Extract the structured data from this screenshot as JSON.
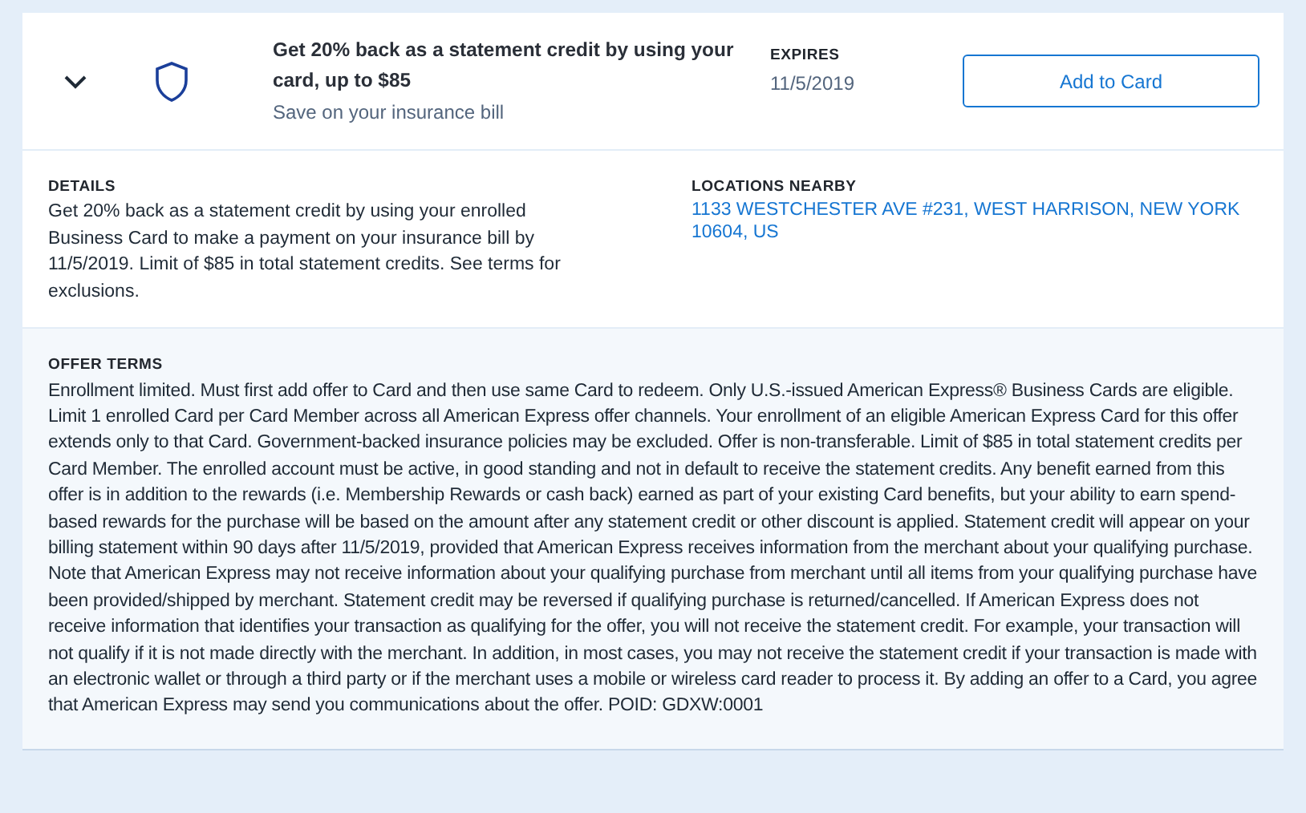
{
  "offer": {
    "expanded": true,
    "title": "Get 20% back as a statement credit by using your card, up to $85",
    "subtitle": "Save on your insurance bill",
    "expires_label": "EXPIRES",
    "expires_date": "11/5/2019",
    "button": "Add to Card"
  },
  "details": {
    "label": "DETAILS",
    "text": "Get 20% back as a statement credit by using your enrolled Business Card to make a payment on your insurance bill by 11/5/2019. Limit of $85 in total statement credits. See terms for exclusions."
  },
  "locations": {
    "label": "LOCATIONS NEARBY",
    "address": "1133 WESTCHESTER AVE #231, WEST HARRISON, NEW YORK 10604, US"
  },
  "terms": {
    "label": "OFFER TERMS",
    "text": "Enrollment limited. Must first add offer to Card and then use same Card to redeem. Only U.S.-issued American Express® Business Cards are eligible. Limit 1 enrolled Card per Card Member across all American Express offer channels. Your enrollment of an eligible American Express Card for this offer extends only to that Card. Government-backed insurance policies may be excluded. Offer is non-transferable. Limit of $85 in total statement credits per Card Member. The enrolled account must be active, in good standing and not in default to receive the statement credits. Any benefit earned from this offer is in addition to the rewards (i.e. Membership Rewards or cash back) earned as part of your existing Card benefits, but your ability to earn spend-based rewards for the purchase will be based on the amount after any statement credit or other discount is applied. Statement credit will appear on your billing statement within 90 days after 11/5/2019, provided that American Express receives information from the merchant about your qualifying purchase. Note that American Express may not receive information about your qualifying purchase from merchant until all items from your qualifying purchase have been provided/shipped by merchant. Statement credit may be reversed if qualifying purchase is returned/cancelled. If American Express does not receive information that identifies your transaction as qualifying for the offer, you will not receive the statement credit. For example, your transaction will not qualify if it is not made directly with the merchant. In addition, in most cases, you may not receive the statement credit if your transaction is made with an electronic wallet or through a third party or if the merchant uses a mobile or wireless card reader to process it. By adding an offer to a Card, you agree that American Express may send you communications about the offer. POID: GDXW:0001"
  }
}
